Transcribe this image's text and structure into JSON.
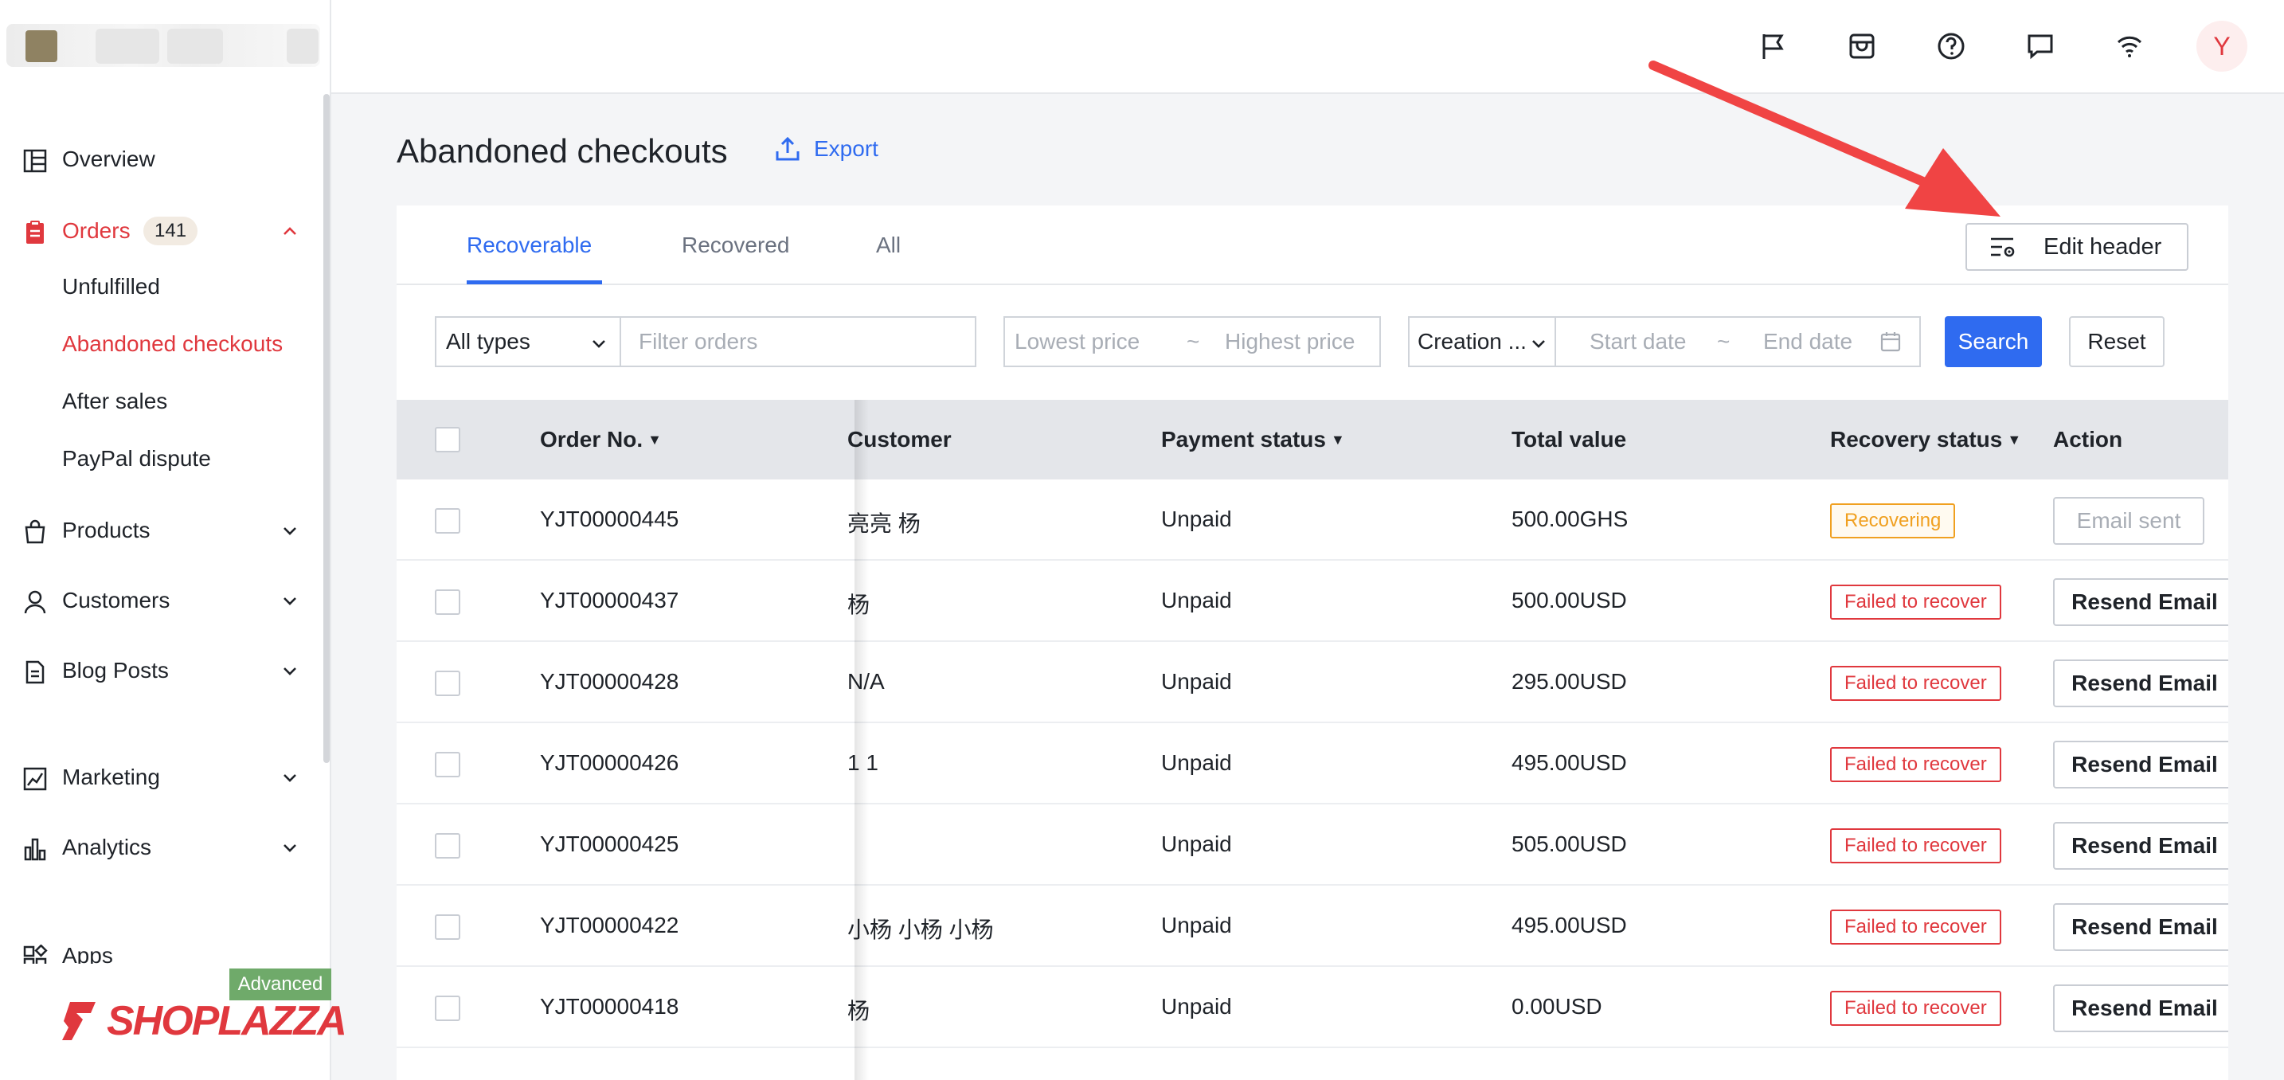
{
  "sidebar": {
    "items": [
      {
        "label": "Overview"
      },
      {
        "label": "Orders",
        "badge": "141"
      },
      {
        "label": "Products"
      },
      {
        "label": "Customers"
      },
      {
        "label": "Blog Posts"
      },
      {
        "label": "Marketing"
      },
      {
        "label": "Analytics"
      },
      {
        "label": "Apps"
      }
    ],
    "orders_sub": [
      "Unfulfilled",
      "Abandoned checkouts",
      "After sales",
      "PayPal dispute"
    ],
    "plan_tag": "Advanced",
    "brand": "SHOPLAZZA"
  },
  "topbar": {
    "icons": [
      "flag-icon",
      "store-icon",
      "help-icon",
      "message-icon",
      "wifi-icon"
    ],
    "avatar_letter": "Y"
  },
  "page": {
    "title": "Abandoned checkouts",
    "export_label": "Export"
  },
  "tabs": [
    "Recoverable",
    "Recovered",
    "All"
  ],
  "edit_header_label": "Edit header",
  "filters": {
    "type_value": "All types",
    "search_placeholder": "Filter orders",
    "lowest_placeholder": "Lowest price",
    "highest_placeholder": "Highest price",
    "tilde": "~",
    "date_type_value": "Creation ...",
    "start_placeholder": "Start date",
    "end_placeholder": "End date",
    "search_button": "Search",
    "reset_button": "Reset"
  },
  "table": {
    "headers": {
      "order_no": "Order No.",
      "customer": "Customer",
      "payment_status": "Payment status",
      "total_value": "Total value",
      "recovery_status": "Recovery status",
      "action": "Action"
    },
    "rows": [
      {
        "order": "YJT00000445",
        "customer": "亮亮 杨",
        "payment": "Unpaid",
        "total": "500.00GHS",
        "recovery": "Recovering",
        "action": "Email sent"
      },
      {
        "order": "YJT00000437",
        "customer": "杨",
        "payment": "Unpaid",
        "total": "500.00USD",
        "recovery": "Failed to recover",
        "action": "Resend Email"
      },
      {
        "order": "YJT00000428",
        "customer": "N/A",
        "payment": "Unpaid",
        "total": "295.00USD",
        "recovery": "Failed to recover",
        "action": "Resend Email"
      },
      {
        "order": "YJT00000426",
        "customer": "1 1",
        "payment": "Unpaid",
        "total": "495.00USD",
        "recovery": "Failed to recover",
        "action": "Resend Email"
      },
      {
        "order": "YJT00000425",
        "customer": "",
        "payment": "Unpaid",
        "total": "505.00USD",
        "recovery": "Failed to recover",
        "action": "Resend Email"
      },
      {
        "order": "YJT00000422",
        "customer": "小杨 小杨 小杨",
        "payment": "Unpaid",
        "total": "495.00USD",
        "recovery": "Failed to recover",
        "action": "Resend Email"
      },
      {
        "order": "YJT00000418",
        "customer": "杨",
        "payment": "Unpaid",
        "total": "0.00USD",
        "recovery": "Failed to recover",
        "action": "Resend Email"
      }
    ]
  },
  "colors": {
    "accent": "#2f6bf0",
    "brand_red": "#e0383e",
    "recovering": "#f0a020",
    "annotation_arrow": "#f04444"
  }
}
